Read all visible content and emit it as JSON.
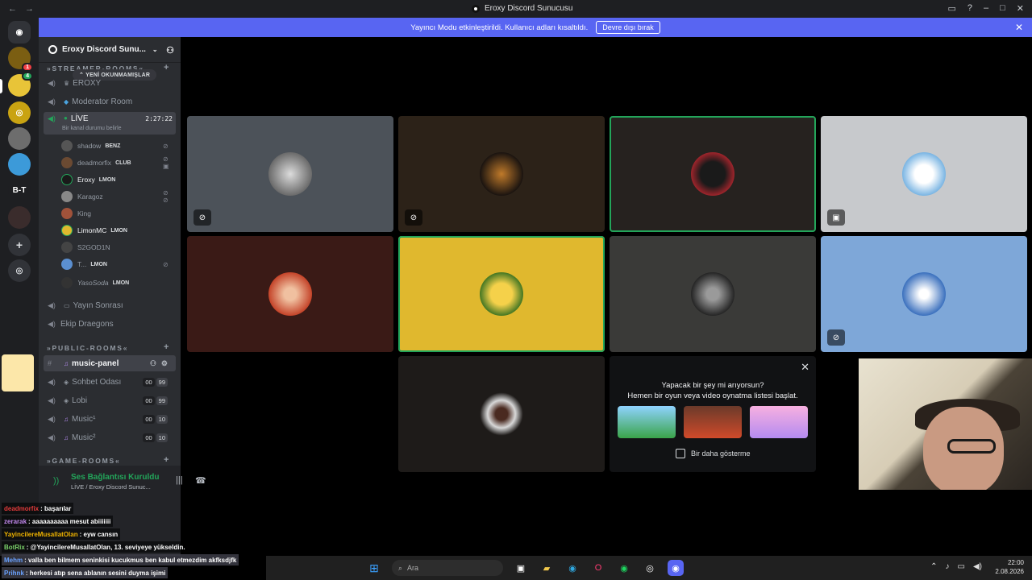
{
  "titlebar": {
    "title": "Eroxy Discord Sunucusu",
    "back": "←",
    "forward": "→"
  },
  "banner": {
    "text": "Yayıncı Modu etkinleştirildi. Kullanıcı adları kısaltıldı.",
    "button": "Devre dışı bırak",
    "close": "✕"
  },
  "rail": {
    "dm_badge": "1",
    "thread_badge": "4",
    "server_label": "B-T"
  },
  "server": {
    "name": "Eroxy Discord Sunu...",
    "chevron": "⌄"
  },
  "new_unreads": "⌃ YENİ OKUNMAMIŞLAR",
  "categories": {
    "streamer": "»STREAMER-ROOMS«",
    "public": "»PUBLIC-ROOMS«",
    "game": "»GAME-ROOMS«"
  },
  "channels": {
    "eroxy": "EROXY",
    "moderator": "Moderator Room",
    "live": "LİVE",
    "live_timer": "2:27:22",
    "live_status": "Bir kanal durumu belirle",
    "yayin_sonrasi": "Yayın Sonrası",
    "ekip": "Ekip Draegons",
    "music_panel": "music-panel",
    "sohbet": "Sohbet Odası",
    "lobi": "Lobi",
    "music1": "Music¹",
    "music2": "Music²",
    "count_00": "00",
    "count_99": "99",
    "count_10": "10"
  },
  "voice_users": [
    {
      "name": "shadow",
      "tag": "BENZ"
    },
    {
      "name": "deadmorfix",
      "tag": "CLUB"
    },
    {
      "name": "Eroxy",
      "tag": "LMON"
    },
    {
      "name": "Karagoz",
      "tag": ""
    },
    {
      "name": "King",
      "tag": ""
    },
    {
      "name": "LimonMC",
      "tag": "LMON"
    },
    {
      "name": "S2GOD1N",
      "tag": ""
    },
    {
      "name": "T...",
      "tag": "LMON"
    },
    {
      "name": "YasoSoda",
      "tag": "LMON"
    }
  ],
  "voice_panel": {
    "connected": "Ses Bağlantısı Kuruldu",
    "channel": "LİVE / Eroxy Discord Sunuc..."
  },
  "chat": [
    {
      "user": "deadmorfix",
      "msg": ": başarılar"
    },
    {
      "user": "zerarak",
      "msg": ": aaaaaaaaaa mesut abiiiiiii"
    },
    {
      "user": "YayincilereMusallatOlan",
      "msg": ": eyw cansın"
    },
    {
      "user": "BotRix",
      "msg": ": @YayincilereMusallatOlan, 13. seviyeye yükseldin."
    },
    {
      "user": "Mehm",
      "msg": ": valla ben bilmem seninkisi kucukmus ben kabul etmezdim akfksdjfk"
    },
    {
      "user": "Prihnk",
      "msg": ": herkesi atıp sena ablanın sesini duyma işimi"
    }
  ],
  "activity": {
    "line1": "Yapacak bir şey mi arıyorsun?",
    "line2": "Hemen bir oyun veya video oynatma listesi başlat.",
    "checkbox": "Bir daha gösterme"
  },
  "taskbar": {
    "search": "Ara",
    "time": "22:00",
    "date": "2.08.2026"
  },
  "colors": {
    "blurple": "#5865f2",
    "green": "#23a55a",
    "tile_yellow": "#e0b82e",
    "tile_blue": "#7ea7d8"
  }
}
